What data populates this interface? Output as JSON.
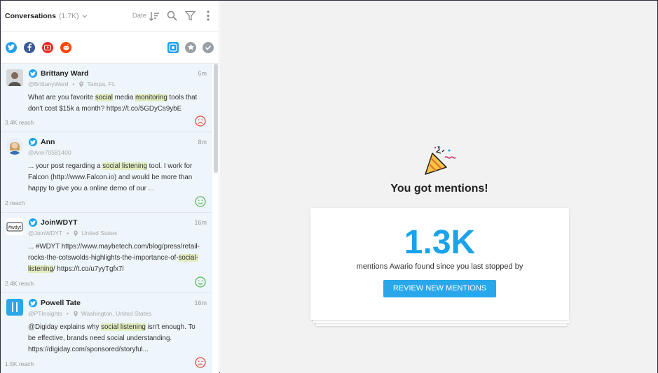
{
  "header": {
    "title": "Conversations",
    "count": "(1.7K)",
    "sort_label": "Date"
  },
  "mentions": [
    {
      "name": "Brittany Ward",
      "handle": "@BrittanyWard",
      "location": "Tampa, FL",
      "time": "6m",
      "text_parts": [
        "What are you favorite ",
        "social",
        " media ",
        "monitoring",
        " tools that don't cost $15k a month? https://t.co/5GDyCs9ybE"
      ],
      "reach": "3.4K reach",
      "sentiment": "negative"
    },
    {
      "name": "Ann",
      "handle": "@Ann70581400",
      "location": "",
      "time": "8m",
      "text_parts": [
        "... your post regarding a ",
        "social listening",
        " tool. I work for Falcon (http://www.Falcon.io) and would be more than happy to give you a online demo of our ..."
      ],
      "reach": "2 reach",
      "sentiment": "positive"
    },
    {
      "name": "JoinWDYT",
      "handle": "@JoinWDYT",
      "location": "United States",
      "time": "16m",
      "text_parts": [
        "... #WDYT https://www.maybetech.com/blog/press/retail-rocks-the-cotswolds-highlights-the-importance-of-",
        "social-listening",
        "/ https://t.co/u7yyTgfx7l"
      ],
      "reach": "2.4K reach",
      "sentiment": "positive"
    },
    {
      "name": "Powell Tate",
      "handle": "@PTInsights",
      "location": "Washington, United States",
      "time": "16m",
      "text_parts": [
        "@Digiday explains why ",
        "social listening",
        " isn't enough. To be effective, brands need social understanding. https://digiday.com/sponsored/storyful..."
      ],
      "reach": "1.5K reach",
      "sentiment": "negative"
    }
  ],
  "panel": {
    "headline": "You got mentions!",
    "big_number": "1.3K",
    "subtitle": "mentions Awario found since you last stopped by",
    "button": "REVIEW NEW MENTIONS"
  },
  "colors": {
    "accent": "#29a7ea",
    "highlight": "#e3ecc0",
    "negative": "#e74c3c",
    "positive": "#5cb85c"
  }
}
